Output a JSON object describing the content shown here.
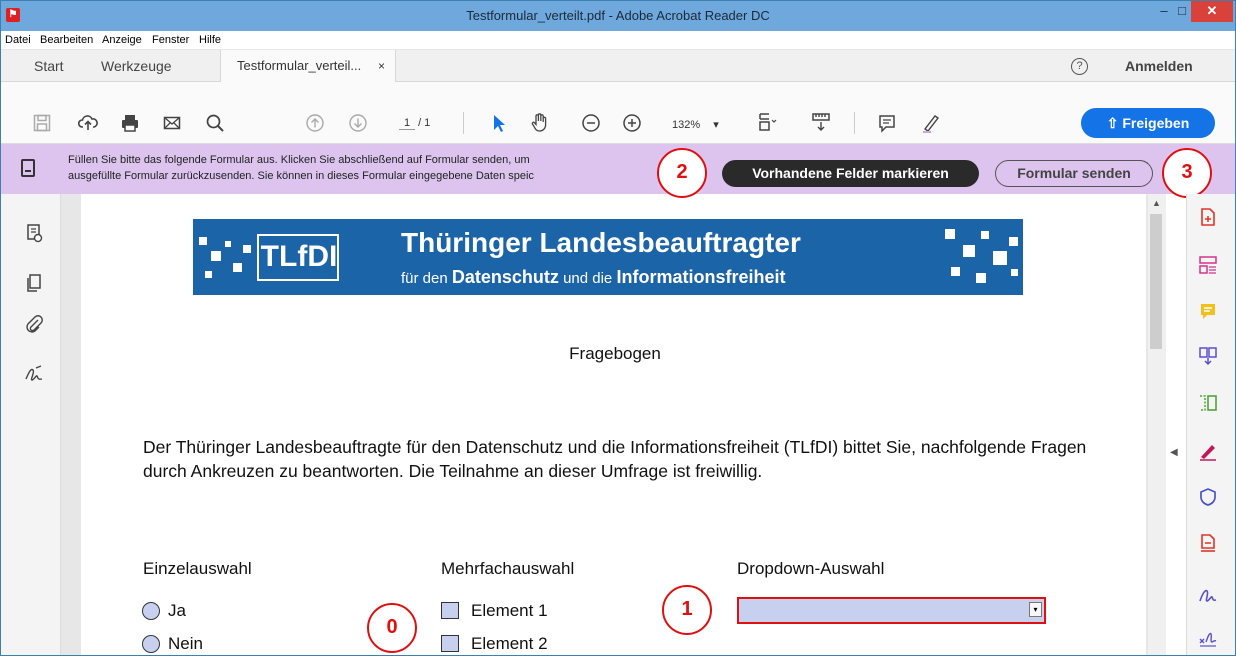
{
  "window": {
    "title": "Testformular_verteilt.pdf - Adobe Acrobat Reader DC",
    "minimize": "–",
    "maximize": "□",
    "close": "✕"
  },
  "menu": [
    "Datei",
    "Bearbeiten",
    "Anzeige",
    "Fenster",
    "Hilfe"
  ],
  "tabs": {
    "start": "Start",
    "tools": "Werkzeuge",
    "document": "Testformular_verteil...",
    "document_close": "×",
    "help": "?",
    "sign_in": "Anmelden"
  },
  "toolbar": {
    "icons": [
      "save-icon",
      "upload-cloud-icon",
      "print-icon",
      "email-icon",
      "search-icon",
      "page-up-icon",
      "page-down-icon",
      "select-arrow-icon",
      "hand-icon",
      "zoom-out-icon",
      "zoom-in-icon",
      "fit-page-icon",
      "scroll-mode-icon",
      "comment-icon",
      "highlight-pen-icon"
    ],
    "page_current": "1",
    "page_total": "/ 1",
    "zoom": "132%",
    "zoom_arrow": "▾",
    "share_label": "Freigeben"
  },
  "form_bar": {
    "message_line1": "Füllen Sie bitte das folgende Formular aus. Klicken Sie abschließend auf Formular senden, um",
    "message_line2": "ausgefüllte Formular zurückzusenden. Sie können in dieses Formular eingegebene Daten speic",
    "highlight_fields": "Vorhandene Felder markieren",
    "submit_form": "Formular senden"
  },
  "callouts": [
    "0",
    "1",
    "2",
    "3"
  ],
  "document": {
    "banner_logo": "TLfDI",
    "banner_title": "Thüringer Landesbeauftragter",
    "banner_sub_1": "für den",
    "banner_sub_2": "Datenschutz",
    "banner_sub_3": "und die",
    "banner_sub_4": "Informationsfreiheit",
    "heading": "Fragebogen",
    "paragraph": "Der Thüringer Landesbeauftragte für den Datenschutz und die Informationsfreiheit (TLfDI) bittet Sie, nachfolgende Fragen durch Ankreuzen zu beantworten. Die Teilnahme an dieser Umfrage ist freiwillig.",
    "single_choice_label": "Einzelauswahl",
    "single_choice_options": [
      "Ja",
      "Nein"
    ],
    "multi_choice_label": "Mehrfachauswahl",
    "multi_choice_options": [
      "Element 1",
      "Element 2"
    ],
    "dropdown_label": "Dropdown-Auswahl",
    "dropdown_value": ""
  },
  "left_rail_icons": [
    "pages-comment-icon",
    "copy-pages-icon",
    "attachment-icon",
    "signature-icon"
  ],
  "right_rail_icons": [
    "export-pdf-icon",
    "organize-pages-icon",
    "comment-icon",
    "combine-files-icon",
    "edit-pdf-icon",
    "fill-sign-icon",
    "protect-icon",
    "create-pdf-icon",
    "sign-icon",
    "more-tools-icon"
  ],
  "colors": {
    "title_bar": "#6fa8dc",
    "form_bar": "#dcc4ee",
    "share_button": "#1473e6",
    "callout": "#e01010",
    "banner": "#1c64a8",
    "field_fill": "#c8d0f0"
  }
}
